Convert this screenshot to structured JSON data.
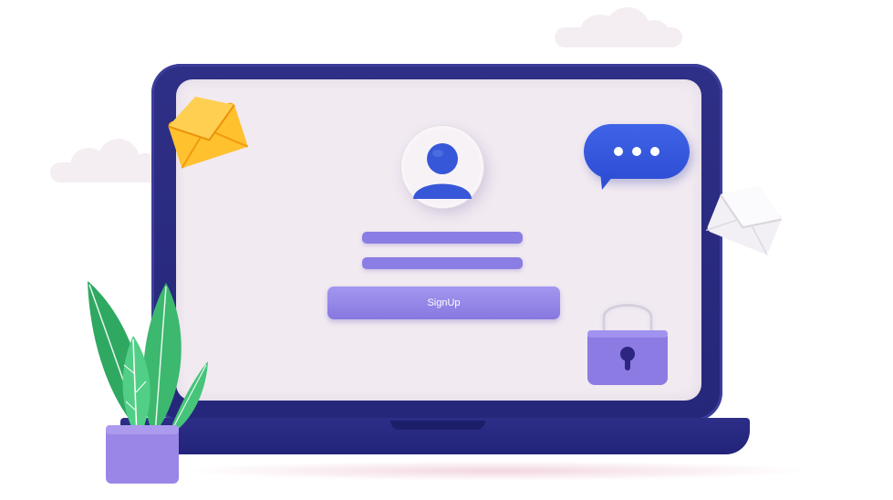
{
  "form": {
    "signup_label": "SignUp"
  },
  "icons": {
    "avatar": "user-avatar-icon",
    "chat": "chat-bubble-icon",
    "lock": "padlock-icon",
    "envelope_yellow": "envelope-icon",
    "envelope_white": "envelope-icon",
    "plant": "potted-plant-icon"
  },
  "colors": {
    "laptop_frame": "#2e2f86",
    "screen": "#f1eaf1",
    "accent_purple": "#8a7de3",
    "chat_blue": "#3355dd",
    "plant_green": "#2eae66",
    "pot_purple": "#9a86e6",
    "envelope_yellow": "#ffb21f"
  }
}
